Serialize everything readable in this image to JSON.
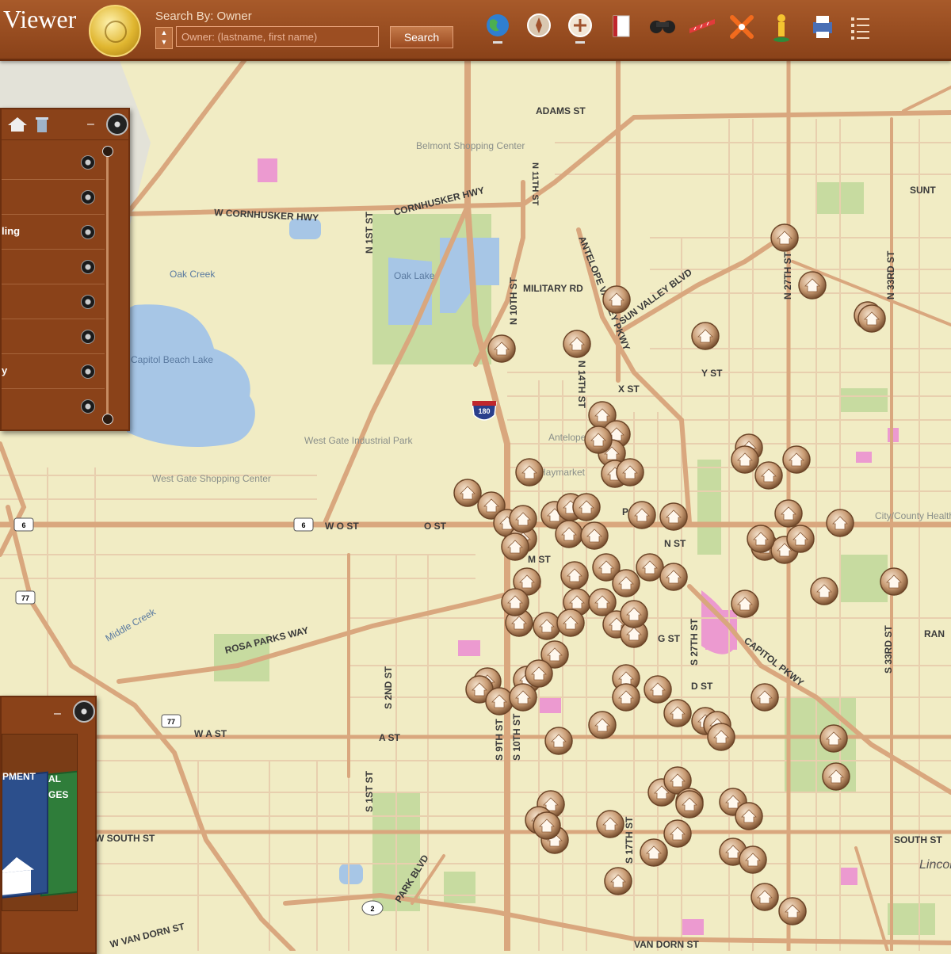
{
  "header": {
    "app_title": "Viewer",
    "search_label": "Search By: Owner",
    "search_placeholder": "Owner: (lastname, first name)",
    "search_button": "Search",
    "tools": [
      "globe-icon",
      "compass-icon",
      "pan-icon",
      "book-icon",
      "binoculars-icon",
      "measure-icon",
      "tools-icon",
      "person-icon",
      "print-icon",
      "list-icon"
    ]
  },
  "layers_panel": {
    "rows": [
      {
        "label": ""
      },
      {
        "label": ""
      },
      {
        "label": "ling"
      },
      {
        "label": ""
      },
      {
        "label": ""
      },
      {
        "label": ""
      },
      {
        "label": "y"
      },
      {
        "label": ""
      }
    ]
  },
  "apps_panel": {
    "book1_title": "PMENT",
    "book2_title": "AL\nGES"
  },
  "map": {
    "colors": {
      "land": "#f1ecc4",
      "major_road": "#d9a77e",
      "minor_road": "#e8cfae",
      "park": "#c7dba0",
      "water": "#a7c6e6",
      "pink": "#ec9ad0"
    },
    "street_labels": [
      "ADAMS ST",
      "W CORNHUSKER HWY",
      "CORNHUSKER HWY",
      "N 1ST ST",
      "N 11TH ST",
      "MILITARY RD",
      "ANTELOPE VALLEY PKWY",
      "SUN VALLEY BLVD",
      "N 14TH ST",
      "X ST",
      "Y ST",
      "N 27TH ST",
      "N 33RD ST",
      "W O ST",
      "O ST",
      "P ST",
      "N ST",
      "M ST",
      "G ST",
      "D ST",
      "ROSA PARKS WAY",
      "W A ST",
      "A ST",
      "S 2ND ST",
      "S 1ST ST",
      "S 9TH ST",
      "S 10TH ST",
      "S 17TH ST",
      "S 27TH ST",
      "S 33RD ST",
      "CAPITOL PKWY",
      "W SOUTH ST",
      "SOUTH ST",
      "PARK BLVD",
      "W VAN DORN ST",
      "VAN DORN ST",
      "SUNT",
      "RAN",
      "N 10TH ST"
    ],
    "place_labels": [
      "Belmont Shopping Center",
      "Oak Lake",
      "Capitol Beach Lake",
      "West Gate Industrial Park",
      "Oak Creek",
      "West Gate Shopping Center",
      "Middle Creek",
      "City/County Health Department",
      "Lincoln",
      "Antelope Valley",
      "Haymarket"
    ],
    "shields": [
      "180",
      "6",
      "6",
      "77",
      "77",
      "2"
    ],
    "marker_icon": "house-marker-icon",
    "marker_count": 93
  }
}
